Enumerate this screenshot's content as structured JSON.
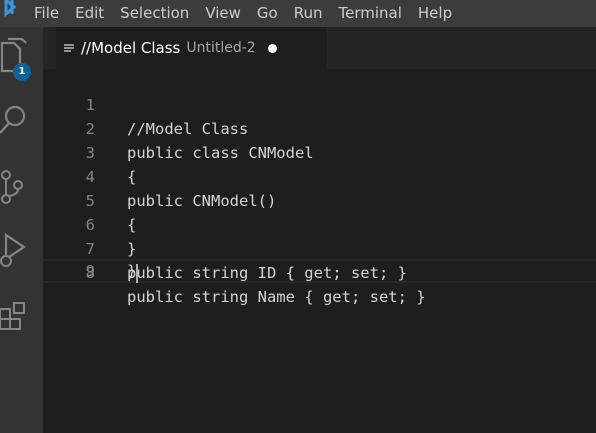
{
  "menubar": {
    "logo_icon": "vscode-logo-icon",
    "items": [
      "File",
      "Edit",
      "Selection",
      "View",
      "Go",
      "Run",
      "Terminal",
      "Help"
    ]
  },
  "activitybar": {
    "items": [
      {
        "icon": "files-icon",
        "badge": "1"
      },
      {
        "icon": "search-icon"
      },
      {
        "icon": "source-control-icon"
      },
      {
        "icon": "run-debug-icon"
      },
      {
        "icon": "extensions-icon"
      }
    ]
  },
  "tab": {
    "icon": "text-lines-icon",
    "title": "//Model Class",
    "description": "Untitled-2",
    "dirty": true
  },
  "editor": {
    "lines": [
      {
        "number": "1",
        "text": "//Model Class"
      },
      {
        "number": "2",
        "text": "public class CNModel"
      },
      {
        "number": "3",
        "text": "{"
      },
      {
        "number": "4",
        "text": "public CNModel()"
      },
      {
        "number": "5",
        "text": "{"
      },
      {
        "number": "6",
        "text": "}"
      },
      {
        "number": "7",
        "text": "public string ID { get; set; }"
      },
      {
        "number": "8",
        "text": "public string Name { get; set; }"
      },
      {
        "number": "9",
        "text": "}"
      }
    ]
  },
  "colors": {
    "menubar_bg": "#3c3c3c",
    "activitybar_bg": "#333333",
    "editor_bg": "#1e1e1e",
    "badge_bg": "#0e639c",
    "text": "#d4d4d4",
    "line_number": "#858585"
  }
}
